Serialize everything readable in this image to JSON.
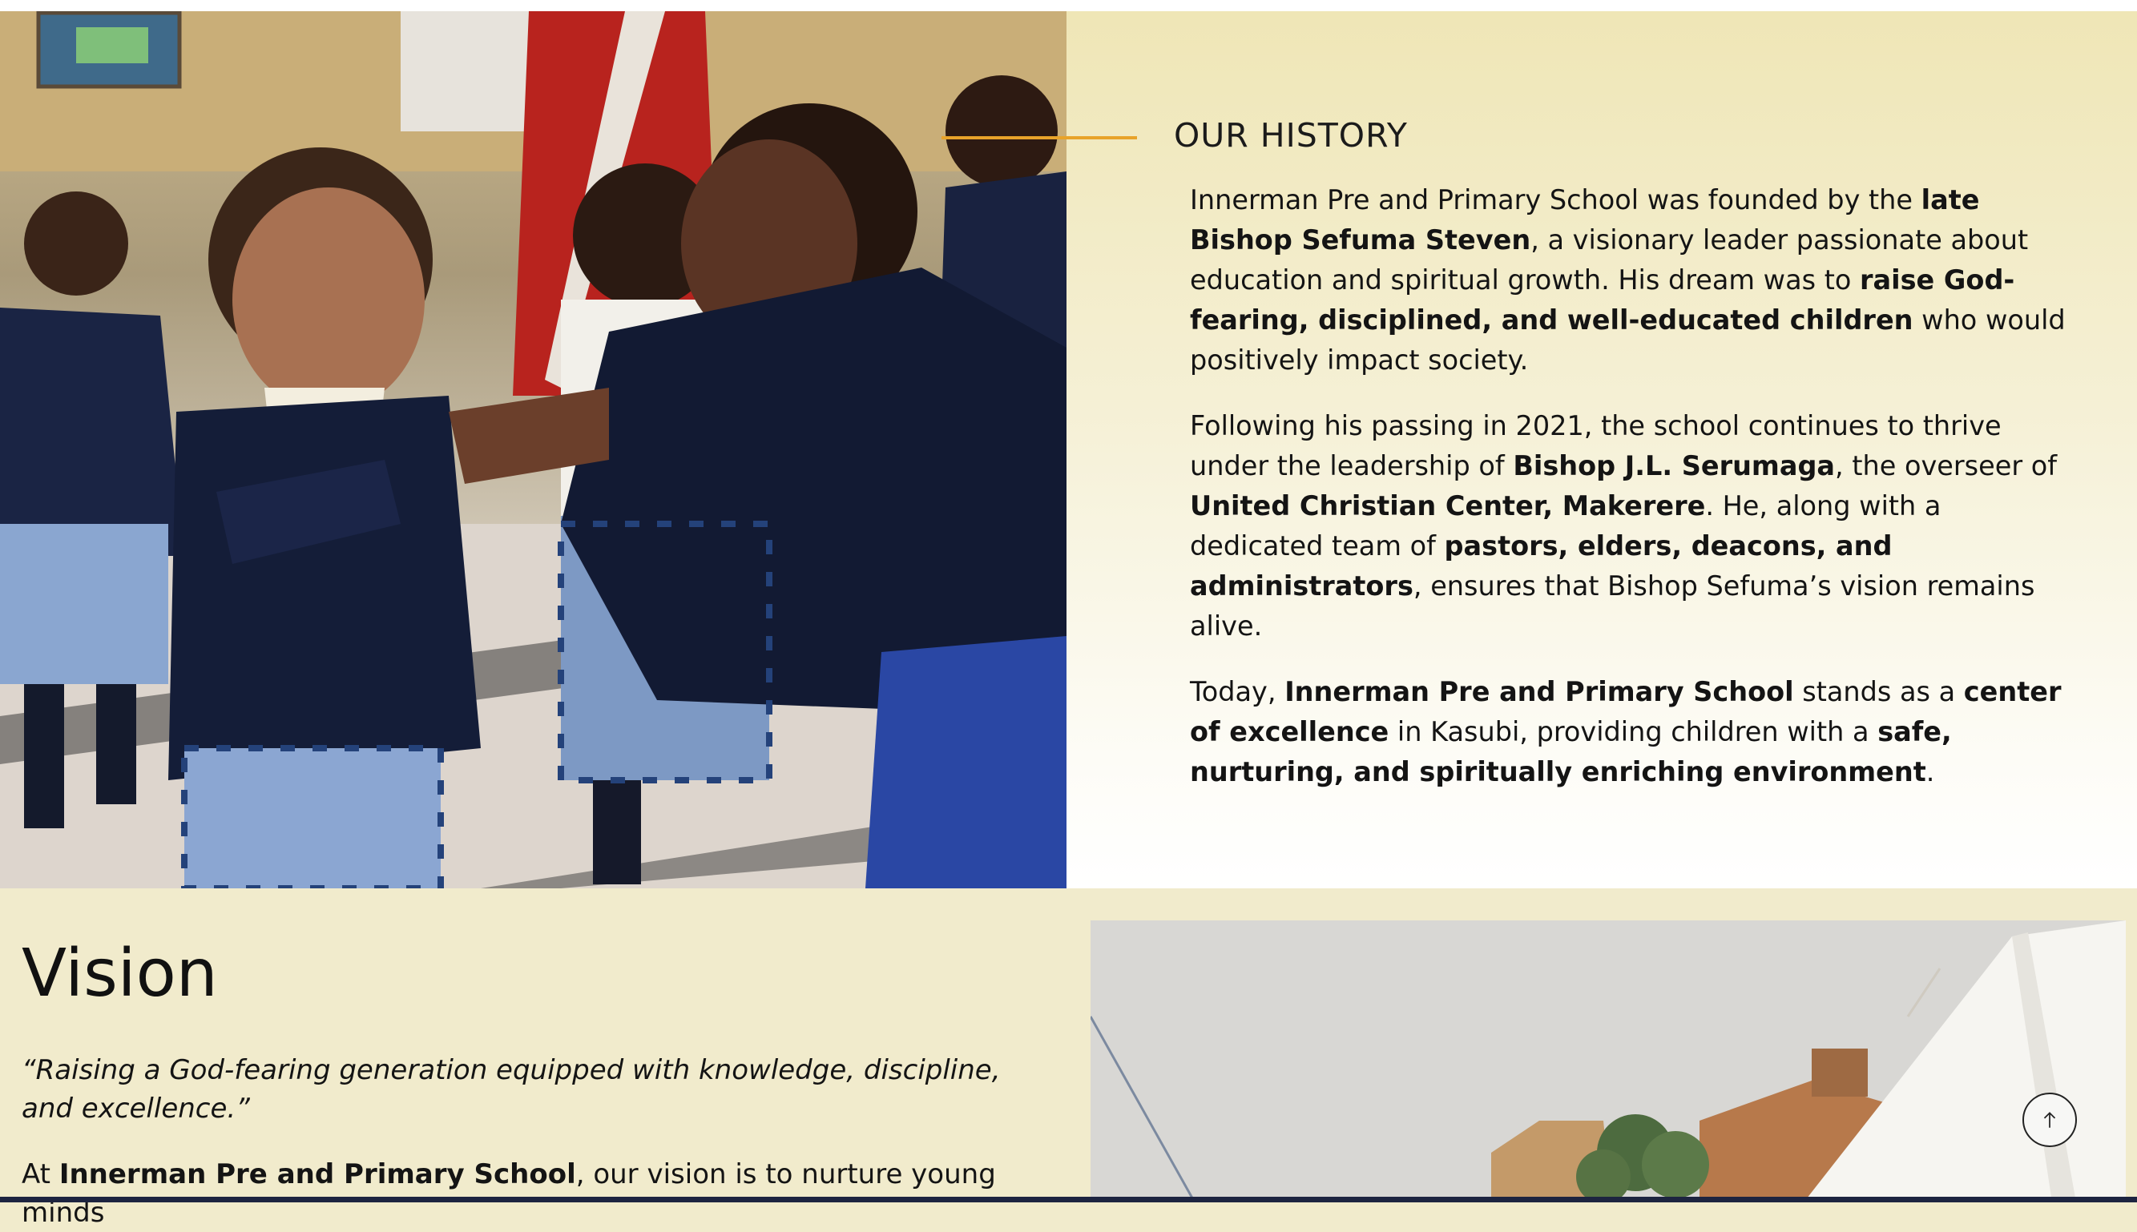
{
  "history": {
    "title": "OUR HISTORY",
    "p1": {
      "t1": "Innerman Pre and Primary School was founded by the ",
      "b1": "late Bishop Sefuma Steven",
      "t2": ", a visionary leader passionate about education and spiritual growth. His dream was to ",
      "b2": "raise God-fearing, disciplined, and well-educated children",
      "t3": " who would positively impact society."
    },
    "p2": {
      "t1": "Following his passing in 2021, the school continues to thrive under the leadership of ",
      "b1": "Bishop J.L. Serumaga",
      "t2": ", the overseer of ",
      "b2": "United Christian Center, Makerere",
      "t3": ". He, along with a dedicated team of ",
      "b3": "pastors, elders, deacons, and administrators",
      "t4": ", ensures that Bishop Sefuma’s vision remains alive."
    },
    "p3": {
      "t1": "Today, ",
      "b1": "Innerman Pre and Primary School",
      "t2": " stands as a ",
      "b2": "center of excellence",
      "t3": " in Kasubi, providing children with a ",
      "b3": "safe, nurturing, and spiritually enriching environment",
      "t4": "."
    }
  },
  "vision": {
    "title": "Vision",
    "quote": "“Raising a God-fearing generation equipped with knowledge, discipline, and excellence.”",
    "body": {
      "t1": "At ",
      "b1": "Innerman Pre and Primary School",
      "t2": ", our vision is to nurture young minds"
    }
  },
  "icons": {
    "scroll_top": "arrow-up-icon"
  },
  "colors": {
    "accent": "#e8a32a",
    "section_bg": "#f1ebcc",
    "bottom_bar": "#1d2440"
  }
}
